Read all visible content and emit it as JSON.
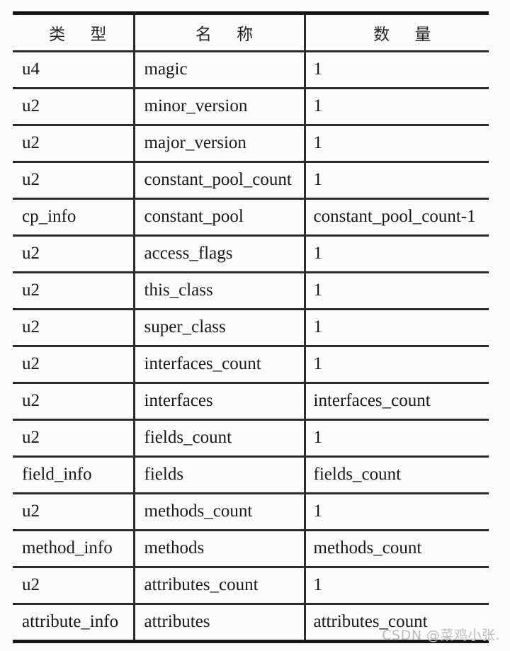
{
  "document": {
    "kind": "scanned-table",
    "background_color": "#fcfcfc",
    "rule_color": "#2a2c2e"
  },
  "table": {
    "headers": {
      "type": "类 型",
      "name": "名 称",
      "count": "数 量"
    },
    "rows": [
      {
        "type": "u4",
        "name": "magic",
        "count": "1"
      },
      {
        "type": "u2",
        "name": "minor_version",
        "count": "1"
      },
      {
        "type": "u2",
        "name": "major_version",
        "count": "1"
      },
      {
        "type": "u2",
        "name": "constant_pool_count",
        "count": "1"
      },
      {
        "type": "cp_info",
        "name": "constant_pool",
        "count": "constant_pool_count-1"
      },
      {
        "type": "u2",
        "name": "access_flags",
        "count": "1"
      },
      {
        "type": "u2",
        "name": "this_class",
        "count": "1"
      },
      {
        "type": "u2",
        "name": "super_class",
        "count": "1"
      },
      {
        "type": "u2",
        "name": "interfaces_count",
        "count": "1"
      },
      {
        "type": "u2",
        "name": "interfaces",
        "count": "interfaces_count"
      },
      {
        "type": "u2",
        "name": "fields_count",
        "count": "1"
      },
      {
        "type": "field_info",
        "name": "fields",
        "count": "fields_count"
      },
      {
        "type": "u2",
        "name": "methods_count",
        "count": "1"
      },
      {
        "type": "method_info",
        "name": "methods",
        "count": "methods_count"
      },
      {
        "type": "u2",
        "name": "attributes_count",
        "count": "1"
      },
      {
        "type": "attribute_info",
        "name": "attributes",
        "count": "attributes_count"
      }
    ]
  },
  "watermark": {
    "text": "CSDN @菜鸡小张.",
    "color": "#b9bcc0"
  }
}
